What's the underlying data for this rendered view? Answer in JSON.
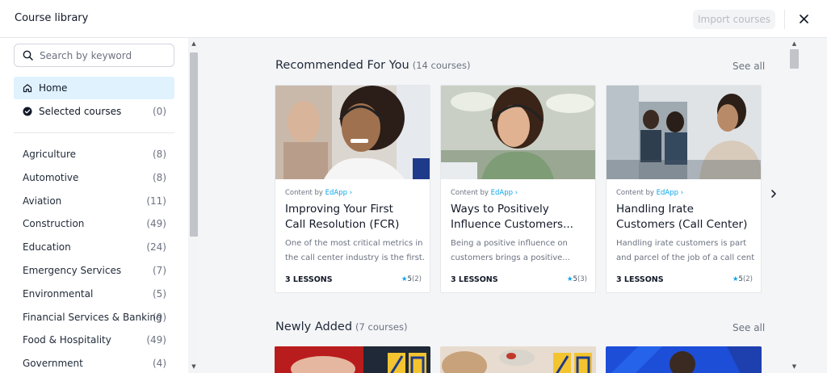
{
  "header": {
    "title": "Course library",
    "import_label": "Import courses",
    "close_icon": "close-icon"
  },
  "search": {
    "placeholder": "Search by keyword"
  },
  "nav": {
    "home_label": "Home",
    "selected_label": "Selected courses",
    "selected_count": "(0)"
  },
  "categories": [
    {
      "label": "Agriculture",
      "count": "(8)"
    },
    {
      "label": "Automotive",
      "count": "(8)"
    },
    {
      "label": "Aviation",
      "count": "(11)"
    },
    {
      "label": "Construction",
      "count": "(49)"
    },
    {
      "label": "Education",
      "count": "(24)"
    },
    {
      "label": "Emergency Services",
      "count": "(7)"
    },
    {
      "label": "Environmental",
      "count": "(5)"
    },
    {
      "label": "Financial Services & Banking",
      "count": "(9)"
    },
    {
      "label": "Food & Hospitality",
      "count": "(49)"
    },
    {
      "label": "Government",
      "count": "(4)"
    }
  ],
  "recommended": {
    "title": "Recommended For You",
    "count": "(14 courses)",
    "see_all": "See all",
    "cards": [
      {
        "content_by": "Content by",
        "provider": "EdApp",
        "title_line1": "Improving Your First",
        "title_line2": "Call Resolution (FCR)",
        "desc_line1": "One of the most critical metrics in",
        "desc_line2": "the call center industry is the first...",
        "lessons": "3 LESSONS",
        "rating": "5",
        "rating_count": "(2)"
      },
      {
        "content_by": "Content by",
        "provider": "EdApp",
        "title_line1": "Ways to Positively",
        "title_line2": "Influence Customers...",
        "desc_line1": "Being a positive influence on",
        "desc_line2": "customers brings a positive...",
        "lessons": "3 LESSONS",
        "rating": "5",
        "rating_count": "(3)"
      },
      {
        "content_by": "Content by",
        "provider": "EdApp",
        "title_line1": "Handling Irate",
        "title_line2": "Customers (Call Center)",
        "desc_line1": "Handling irate customers is part",
        "desc_line2": "and parcel of the job of a call cent...",
        "lessons": "3 LESSONS",
        "rating": "5",
        "rating_count": "(2)"
      }
    ]
  },
  "newly_added": {
    "title": "Newly Added",
    "count": "(7 courses)",
    "see_all": "See all"
  },
  "colors": {
    "accent": "#0ea5e9",
    "active_bg": "#e0f2fe",
    "main_bg": "#f4f5f7"
  }
}
